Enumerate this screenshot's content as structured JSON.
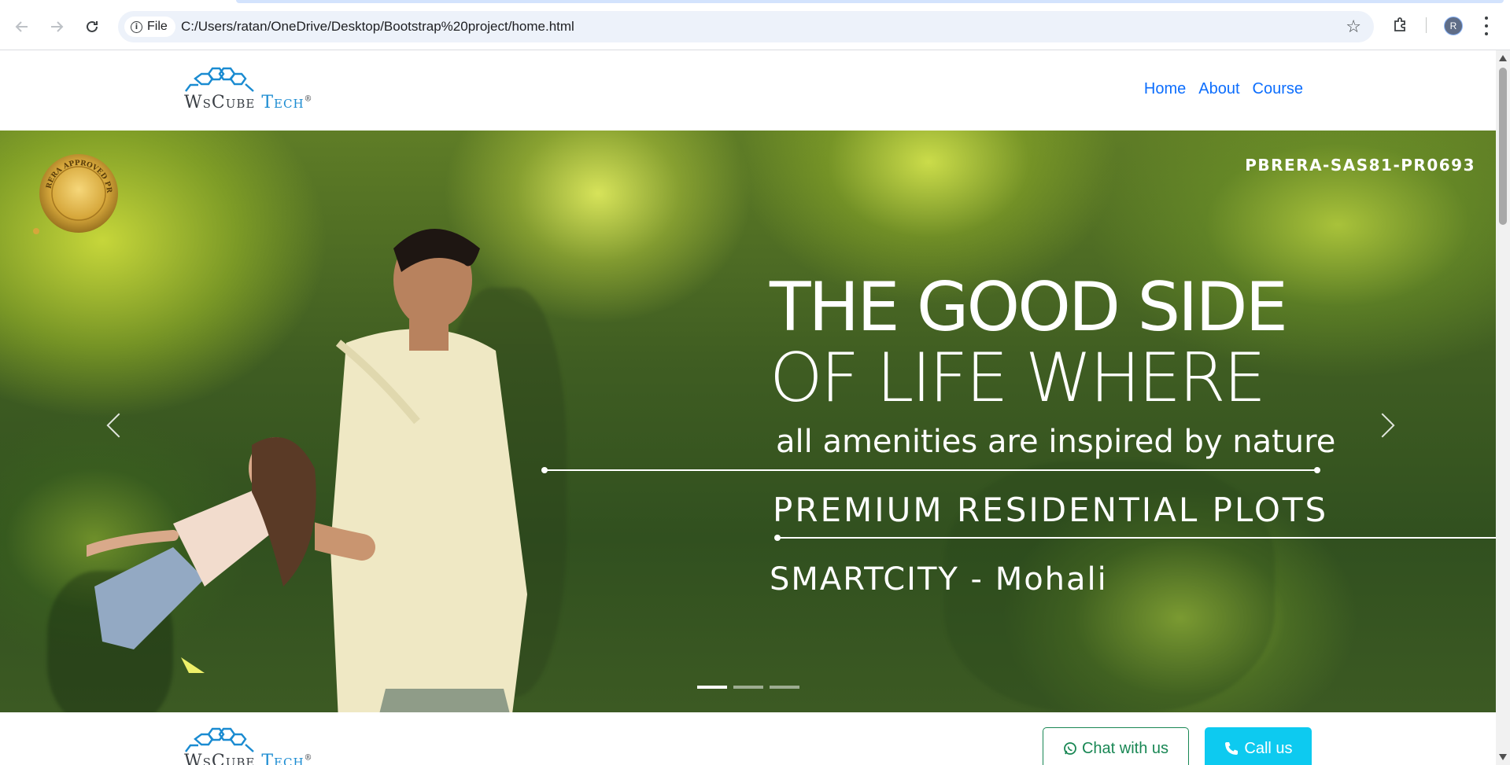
{
  "browser": {
    "file_chip": "File",
    "url": "C:/Users/ratan/OneDrive/Desktop/Bootstrap%20project/home.html",
    "profile_initial": "R"
  },
  "header": {
    "logo_part1": "WsCube",
    "logo_part2": "Tech",
    "logo_mark": "®",
    "nav": [
      "Home",
      "About",
      "Course"
    ]
  },
  "carousel": {
    "rera_code": "PBRERA-SAS81-PR0693",
    "seal_text": "RERA APPROVED PROJECT",
    "headline_line1": "THE GOOD SIDE",
    "headline_line2": "OF LIFE WHERE",
    "subline": "all amenities are inspired by nature",
    "premium": "PREMIUM RESIDENTIAL PLOTS",
    "location": "SMARTCITY - Mohali",
    "slide_count": 3,
    "active_slide": 1
  },
  "footer": {
    "logo_part1": "WsCube",
    "logo_part2": "Tech",
    "logo_mark": "®",
    "chat_label": "Chat with us",
    "call_label": "Call us"
  },
  "colors": {
    "link": "#0d6efd",
    "logo_blue": "#1a8bd1",
    "chat_green": "#198754",
    "call_cyan": "#0dcaf0"
  }
}
